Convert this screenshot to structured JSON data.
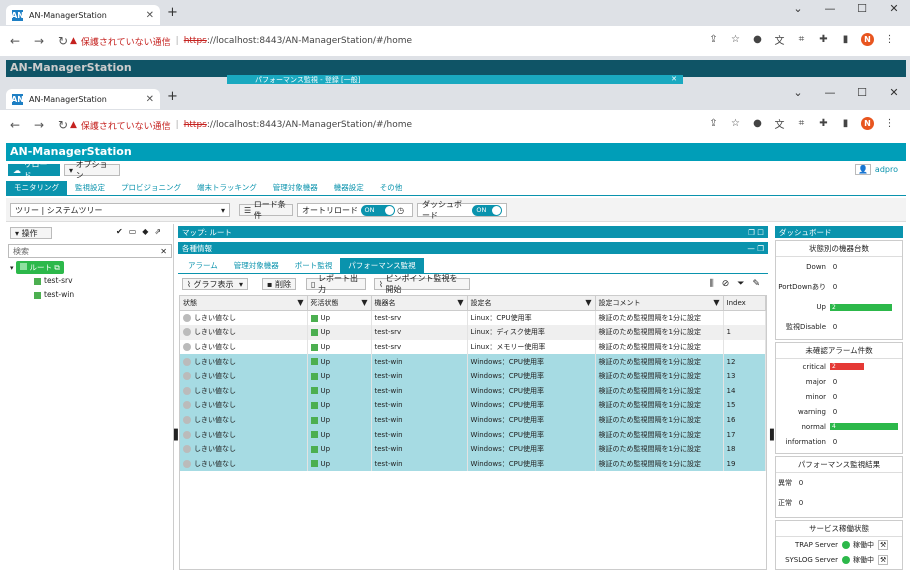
{
  "browser": {
    "tab_title": "AN-ManagerStation",
    "tab_icon": "AN",
    "url_warning": "保護されていない通信",
    "url_scheme": "https",
    "url_rest": "://localhost:8443/AN-ManagerStation/#/home",
    "avatar": "N"
  },
  "background": {
    "app_title": "AN-ManagerStation",
    "dialog_title": "パフォーマンス監視 - 登録 [一般]"
  },
  "app": {
    "title": "AN-ManagerStation",
    "reload": "リロード",
    "options": "オプション",
    "user": "adpro",
    "menu": [
      "モニタリング",
      "監視設定",
      "プロビジョニング",
      "端末トラッキング",
      "管理対象機器",
      "機器設定",
      "その他"
    ],
    "tree_label": "ツリー",
    "tree_value": "システムツリー",
    "load_cond": "ロード条件",
    "auto_reload": "オートリロード",
    "auto_reload_state": "ON",
    "dashboard": "ダッシュボード",
    "dashboard_state": "ON",
    "ops": "操作",
    "search_placeholder": "検索",
    "tree": {
      "root": "ルート",
      "children": [
        "test-srv",
        "test-win"
      ]
    },
    "map_title": "マップ: ルート",
    "info_title": "各種情報",
    "tabs": [
      "アラーム",
      "管理対象機器",
      "ポート監視",
      "パフォーマンス監視"
    ],
    "table_tools": {
      "graph": "グラフ表示",
      "delete": "削除",
      "report": "レポート出力",
      "pinpoint": "ピンポイント監視を開始"
    },
    "columns": [
      "状態",
      "死活状態",
      "機器名",
      "設定名",
      "設定コメント",
      "Index"
    ],
    "rows": [
      {
        "state": "しきい値なし",
        "alive": "Up",
        "device": "test-srv",
        "setting": "Linux：CPU使用率",
        "comment": "検証のため監視間隔を1分に設定",
        "index": ""
      },
      {
        "state": "しきい値なし",
        "alive": "Up",
        "device": "test-srv",
        "setting": "Linux：ディスク使用率",
        "comment": "検証のため監視間隔を1分に設定",
        "index": "1"
      },
      {
        "state": "しきい値なし",
        "alive": "Up",
        "device": "test-srv",
        "setting": "Linux：メモリー使用率",
        "comment": "検証のため監視間隔を1分に設定",
        "index": ""
      },
      {
        "state": "しきい値なし",
        "alive": "Up",
        "device": "test-win",
        "setting": "Windows：CPU使用率",
        "comment": "検証のため監視間隔を1分に設定",
        "index": "12"
      },
      {
        "state": "しきい値なし",
        "alive": "Up",
        "device": "test-win",
        "setting": "Windows：CPU使用率",
        "comment": "検証のため監視間隔を1分に設定",
        "index": "13"
      },
      {
        "state": "しきい値なし",
        "alive": "Up",
        "device": "test-win",
        "setting": "Windows：CPU使用率",
        "comment": "検証のため監視間隔を1分に設定",
        "index": "14"
      },
      {
        "state": "しきい値なし",
        "alive": "Up",
        "device": "test-win",
        "setting": "Windows：CPU使用率",
        "comment": "検証のため監視間隔を1分に設定",
        "index": "15"
      },
      {
        "state": "しきい値なし",
        "alive": "Up",
        "device": "test-win",
        "setting": "Windows：CPU使用率",
        "comment": "検証のため監視間隔を1分に設定",
        "index": "16"
      },
      {
        "state": "しきい値なし",
        "alive": "Up",
        "device": "test-win",
        "setting": "Windows：CPU使用率",
        "comment": "検証のため監視間隔を1分に設定",
        "index": "17"
      },
      {
        "state": "しきい値なし",
        "alive": "Up",
        "device": "test-win",
        "setting": "Windows：CPU使用率",
        "comment": "検証のため監視間隔を1分に設定",
        "index": "18"
      },
      {
        "state": "しきい値なし",
        "alive": "Up",
        "device": "test-win",
        "setting": "Windows：CPU使用率",
        "comment": "検証のため監視間隔を1分に設定",
        "index": "19"
      }
    ],
    "dash_title": "ダッシュボード",
    "device_status": {
      "title": "状態別の機器台数",
      "items": [
        {
          "label": "Down",
          "value": "0"
        },
        {
          "label": "PortDownあり",
          "value": "0"
        },
        {
          "label": "Up",
          "value": "2"
        },
        {
          "label": "監視Disable",
          "value": "0"
        }
      ]
    },
    "alarms": {
      "title": "未確認アラーム件数",
      "items": [
        {
          "label": "critical",
          "value": "2"
        },
        {
          "label": "major",
          "value": "0"
        },
        {
          "label": "minor",
          "value": "0"
        },
        {
          "label": "warning",
          "value": "0"
        },
        {
          "label": "normal",
          "value": "4"
        },
        {
          "label": "information",
          "value": "0"
        }
      ]
    },
    "perf": {
      "title": "パフォーマンス監視結果",
      "items": [
        {
          "label": "異常",
          "value": "0"
        },
        {
          "label": "正常",
          "value": "0"
        }
      ]
    },
    "service": {
      "title": "サービス稼働状態",
      "items": [
        {
          "label": "TRAP Server",
          "value": "稼働中"
        },
        {
          "label": "SYSLOG Server",
          "value": "稼働中"
        }
      ]
    }
  }
}
